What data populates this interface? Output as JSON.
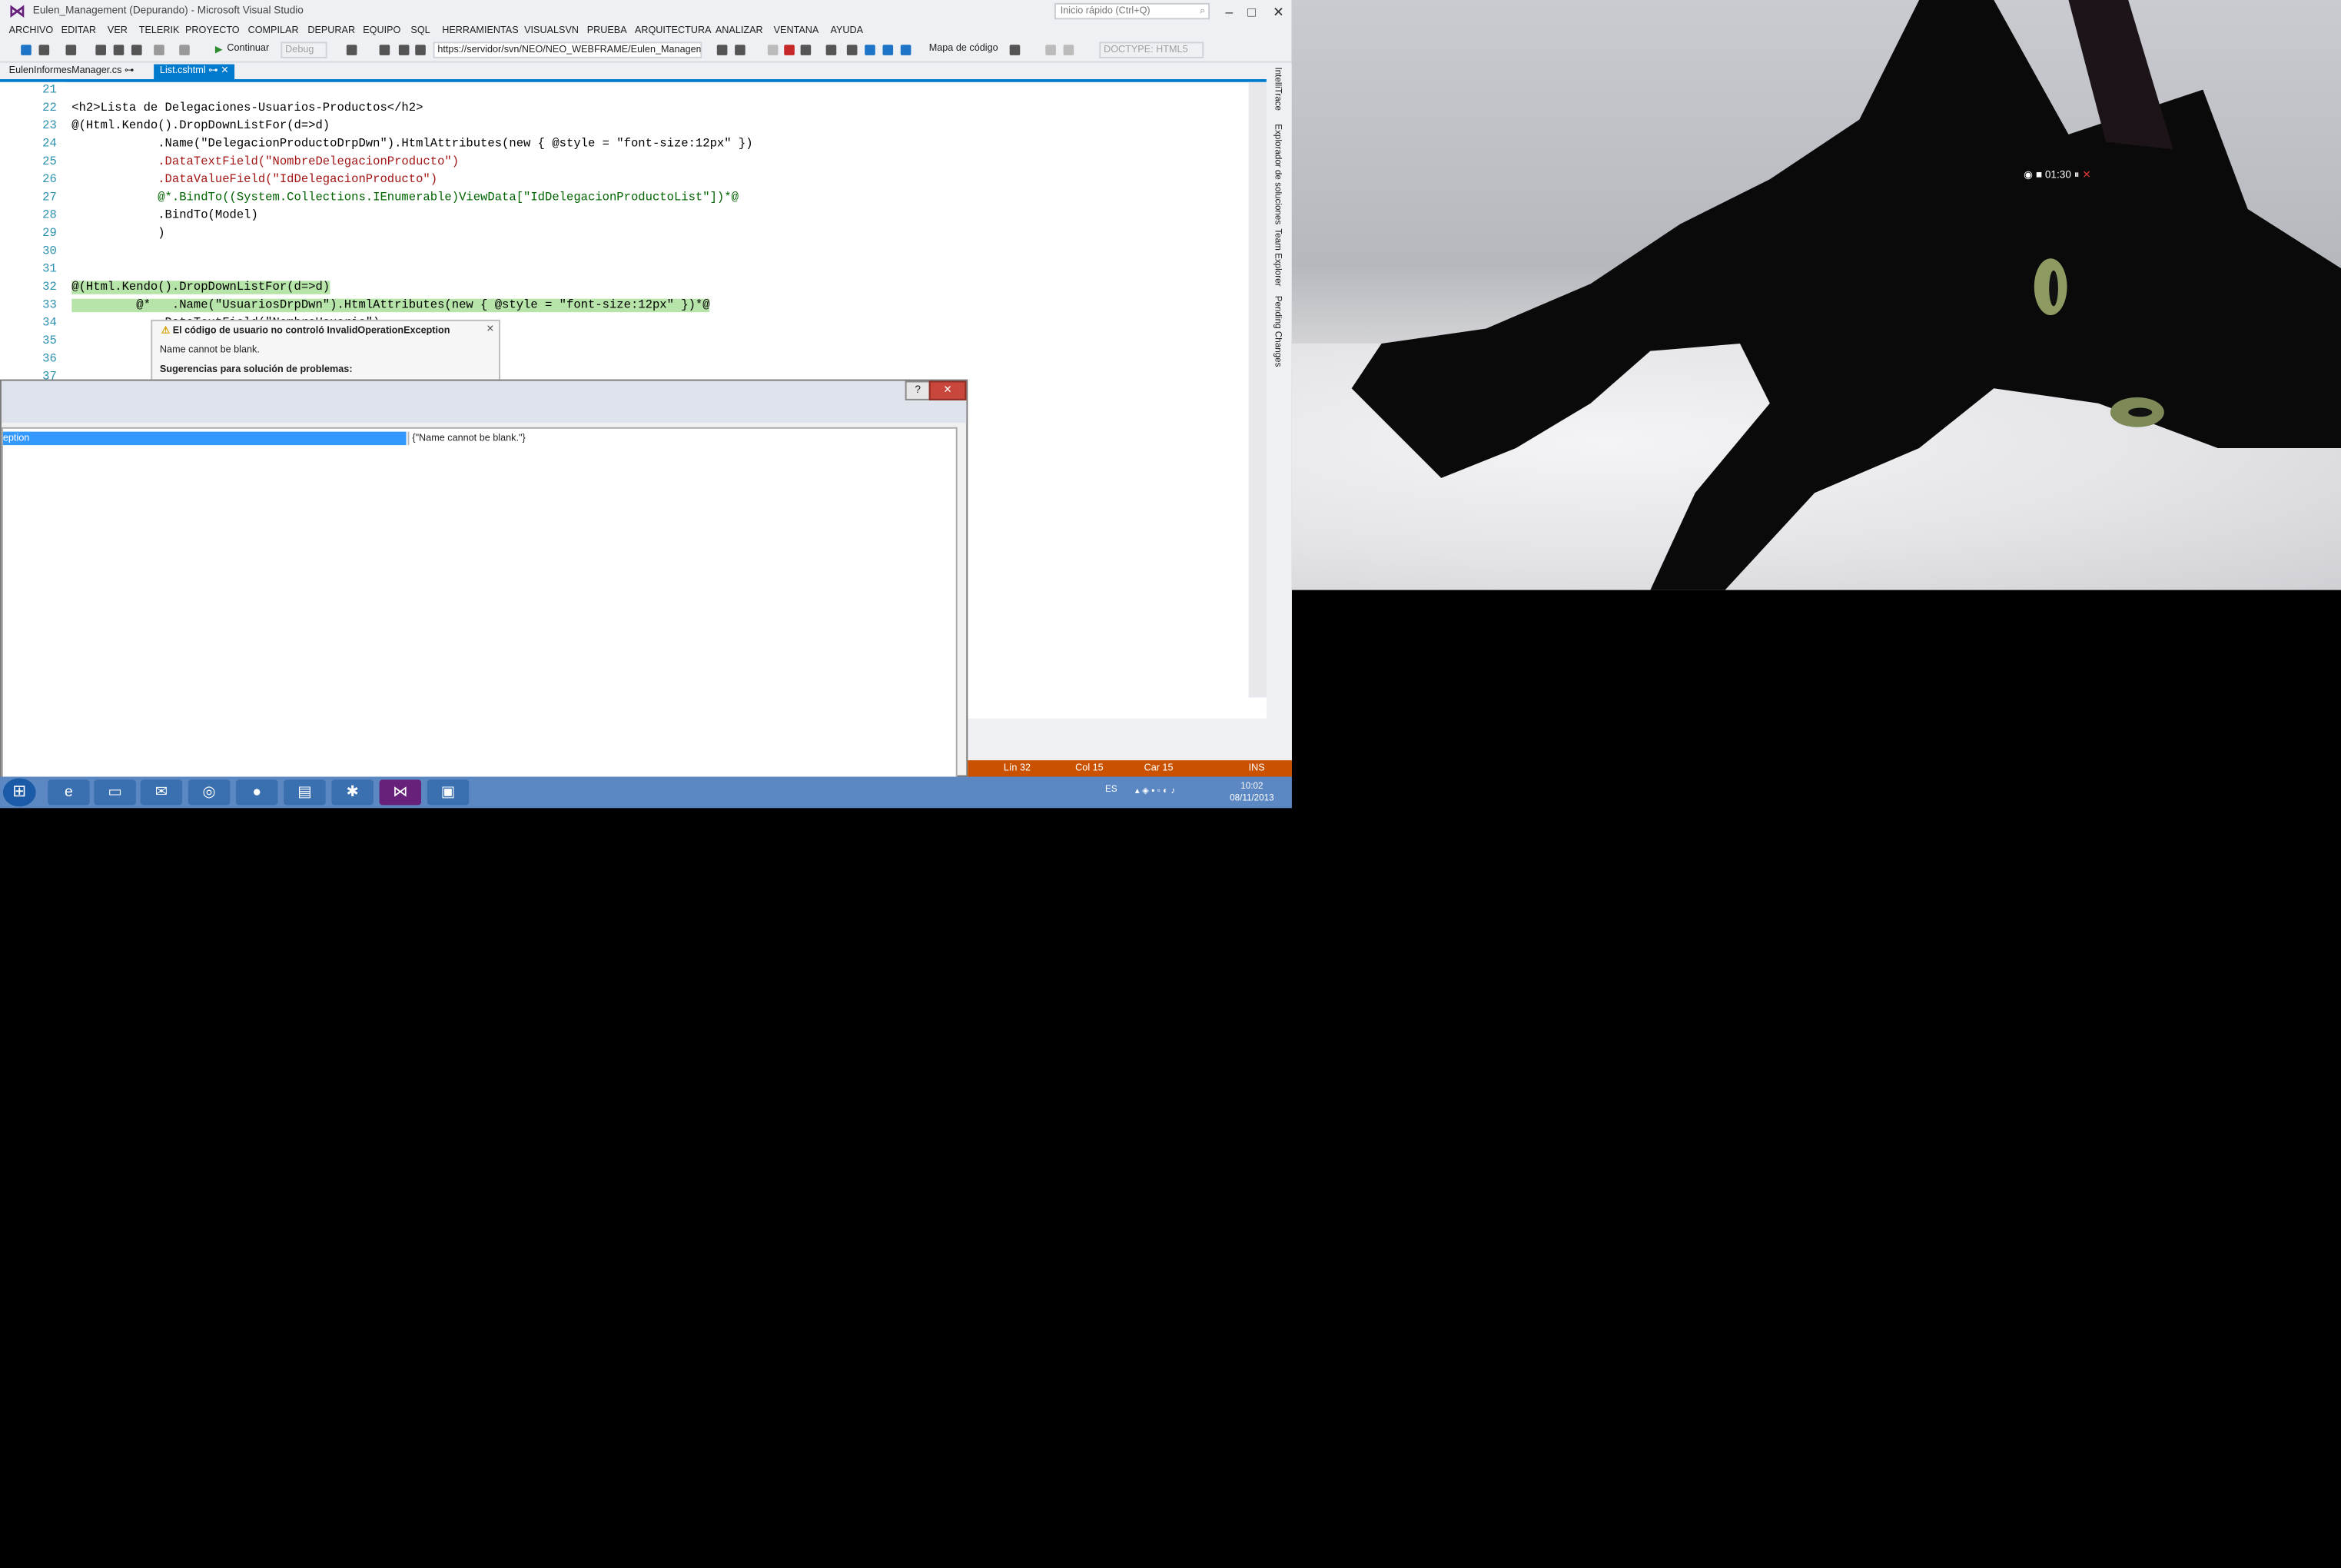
{
  "window": {
    "title": "Eulen_Management (Depurando) - Microsoft Visual Studio",
    "quick_launch_placeholder": "Inicio rápido (Ctrl+Q)"
  },
  "menu": [
    "ARCHIVO",
    "EDITAR",
    "VER",
    "TELERIK",
    "PROYECTO",
    "COMPILAR",
    "DEPURAR",
    "EQUIPO",
    "SQL",
    "HERRAMIENTAS",
    "VISUALSVN",
    "PRUEBA",
    "ARQUITECTURA",
    "ANALIZAR",
    "VENTANA",
    "AYUDA"
  ],
  "toolbar": {
    "continue_label": "Continuar",
    "config_value": "Debug",
    "url_value": "https://servidor/svn/NEO/NEO_WEBFRAME/Eulen_Manageme",
    "code_map_label": "Mapa de código",
    "doctype_value": "DOCTYPE: HTML5"
  },
  "tabs": [
    "EulenInformesManager.cs",
    "List.cshtml"
  ],
  "code_lines": [
    {
      "n": "21",
      "text": ""
    },
    {
      "n": "22",
      "text": "<h2>Lista de Delegaciones-Usuarios-Productos</h2>"
    },
    {
      "n": "23",
      "text": "@(Html.Kendo().DropDownListFor(d=>d)"
    },
    {
      "n": "24",
      "text": "            .Name(\"DelegacionProductoDrpDwn\").HtmlAttributes(new { @style = \"font-size:12px\" })"
    },
    {
      "n": "25",
      "text": "            .DataTextField(\"NombreDelegacionProducto\")"
    },
    {
      "n": "26",
      "text": "            .DataValueField(\"IdDelegacionProducto\")"
    },
    {
      "n": "27",
      "text": "            @*.BindTo((System.Collections.IEnumerable)ViewData[\"IdDelegacionProductoList\"])*@"
    },
    {
      "n": "28",
      "text": "            .BindTo(Model)"
    },
    {
      "n": "29",
      "text": "            )"
    },
    {
      "n": "30",
      "text": ""
    },
    {
      "n": "31",
      "text": ""
    },
    {
      "n": "32",
      "text": "@(Html.Kendo().DropDownListFor(d=>d)"
    },
    {
      "n": "33",
      "text": "         @*   .Name(\"UsuariosDrpDwn\").HtmlAttributes(new { @style = \"font-size:12px\" })*@"
    },
    {
      "n": "34",
      "text": "            .DataTextField(\"NombreUsuario\")"
    },
    {
      "n": "35",
      "text": ""
    },
    {
      "n": "36",
      "text": ""
    },
    {
      "n": "37",
      "text": ""
    }
  ],
  "exception_popup": {
    "header": "El código de usuario no controló InvalidOperationException",
    "message": "Name cannot be blank.",
    "suggestions": "Sugerencias para solución de problemas:"
  },
  "dialog": {
    "selected_row": "eption",
    "value": "{\"Name cannot be blank.\"}"
  },
  "side_tabs": [
    "IntelliTrace",
    "Explorador de soluciones",
    "Team Explorer",
    "Pending Changes"
  ],
  "status": {
    "line": "Lín 32",
    "col": "Col 15",
    "car": "Car 15",
    "mode": "INS"
  },
  "taskbar": {
    "lang": "ES",
    "time": "10:02",
    "date": "08/11/2013"
  },
  "video_overlay": {
    "time": "01:30"
  }
}
